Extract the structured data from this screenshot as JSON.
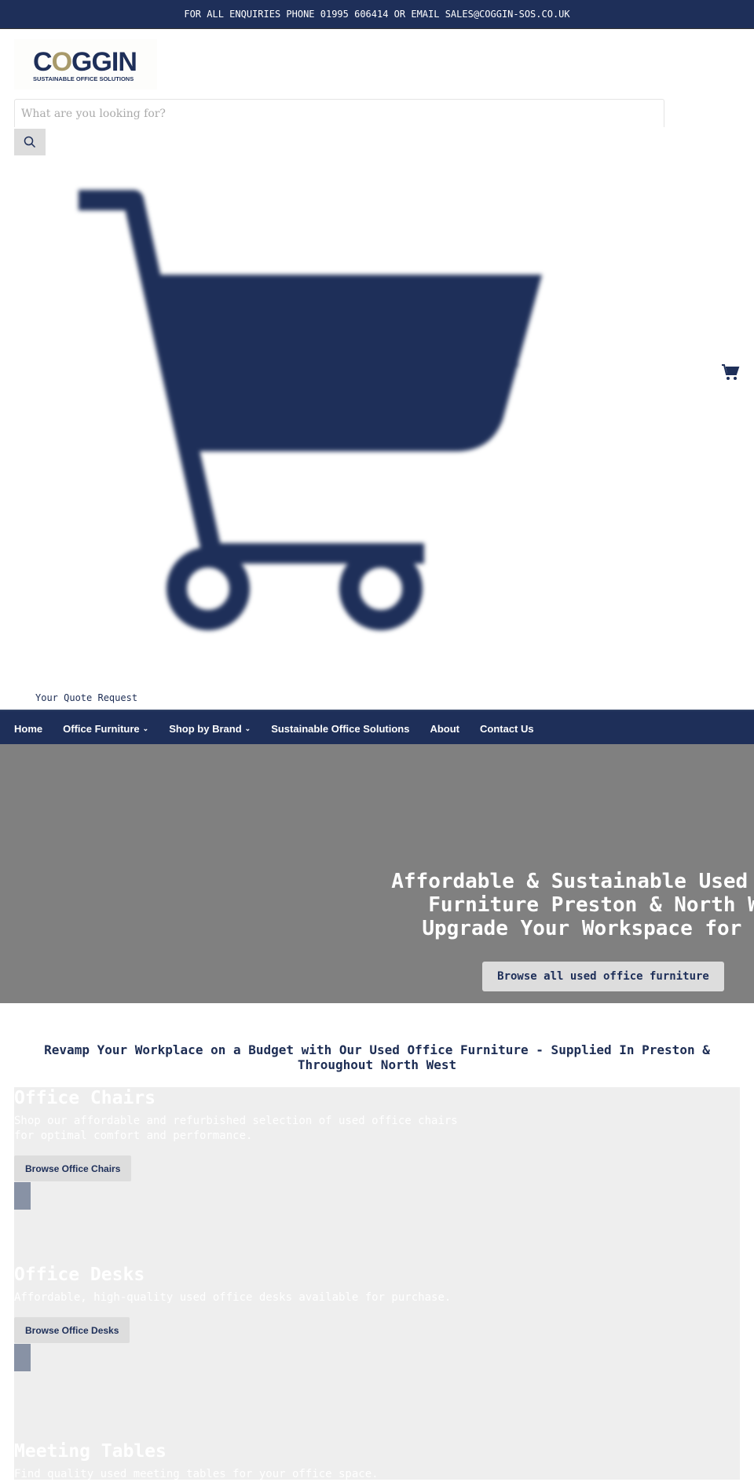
{
  "announcement": "FOR ALL ENQUIRIES PHONE 01995 606414 OR EMAIL SALES@COGGIN-SOS.CO.UK",
  "logo": {
    "word_c": "C",
    "word_o": "O",
    "word_rest": "GGIN",
    "tagline": "SUSTAINABLE OFFICE SOLUTIONS"
  },
  "search": {
    "placeholder": "What are you looking for?",
    "value": ""
  },
  "quote_request": "Your Quote Request",
  "nav": {
    "items": [
      {
        "label": "Home"
      },
      {
        "label": "Office Furniture",
        "dropdown": true
      },
      {
        "label": "Shop by Brand",
        "dropdown": true
      },
      {
        "label": "Sustainable Office Solutions"
      },
      {
        "label": "About"
      },
      {
        "label": "Contact Us"
      }
    ]
  },
  "hero": {
    "line1": "Affordable & Sustainable Used Office",
    "line2": "Furniture Preston & North West",
    "line3": "Upgrade Your Workspace for Less",
    "cta": "Browse all used office furniture"
  },
  "intro": "Revamp Your Workplace on a Budget with Our Used Office Furniture - Supplied In Preston & Throughout North West",
  "categories": [
    {
      "title": "Office Chairs",
      "description": "Shop our affordable and refurbished selection of used office chairs for optimal comfort and performance.",
      "button": "Browse Office Chairs"
    },
    {
      "title": "Office Desks",
      "description": "Affordable, high-quality used office desks available for purchase.",
      "button": "Browse Office Desks"
    },
    {
      "title": "Meeting Tables",
      "description": "Find quality used meeting tables for your office space."
    }
  ],
  "colors": {
    "brand": "#1e2f59",
    "accent": "#a89a6a",
    "hero_bg": "#808080",
    "category_bg": "#eeeeee"
  }
}
